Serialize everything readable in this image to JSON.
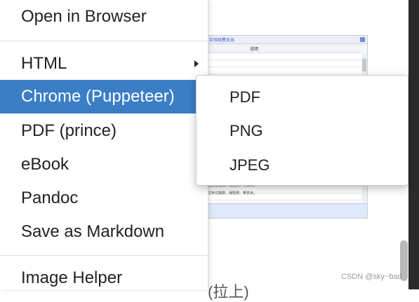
{
  "menu": {
    "items": [
      {
        "label": "Open in Browser"
      },
      {
        "label": "HTML"
      },
      {
        "label": "Chrome (Puppeteer)"
      },
      {
        "label": "PDF (prince)"
      },
      {
        "label": "eBook"
      },
      {
        "label": "Pandoc"
      },
      {
        "label": "Save as Markdown"
      },
      {
        "label": "Image Helper"
      }
    ],
    "active_item": "Chrome (Puppeteer)",
    "submenu_arrow": "chevron-right-icon"
  },
  "submenu": {
    "items": [
      {
        "label": "PDF"
      },
      {
        "label": "PNG"
      },
      {
        "label": "JPEG"
      }
    ]
  },
  "background": {
    "embedded_shot": {
      "tab_text": "实验经费支出",
      "column_header": "说明",
      "row_text_1": "……过桥过隧费、保险费、等支出。",
      "row_text_2": "……过桥过隧费、保险费、等支出。"
    },
    "partial_text": "(拉上)",
    "watermark": "CSDN @sky~bad"
  },
  "colors": {
    "active_bg": "#3b7ec6",
    "active_text": "#ffffff",
    "text": "#222222"
  }
}
